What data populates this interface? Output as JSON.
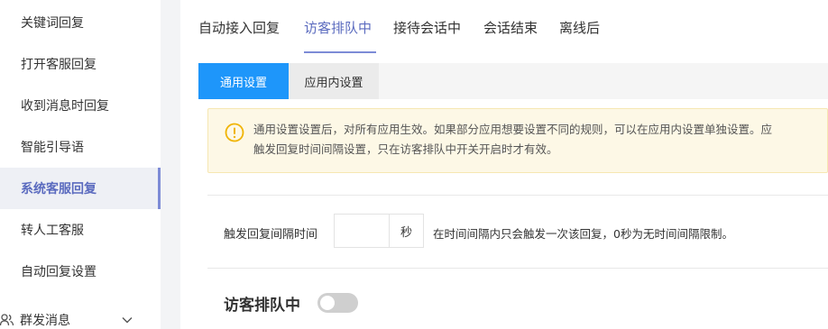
{
  "sidebar": {
    "items": [
      {
        "label": "关键词回复"
      },
      {
        "label": "打开客服回复"
      },
      {
        "label": "收到消息时回复"
      },
      {
        "label": "智能引导语"
      },
      {
        "label": "系统客服回复"
      },
      {
        "label": "转人工客服"
      },
      {
        "label": "自动回复设置"
      }
    ],
    "group": {
      "label": "群发消息",
      "icon": "users-icon",
      "chevron": "chevron-down-icon"
    }
  },
  "tabs": [
    {
      "label": "自动接入回复"
    },
    {
      "label": "访客排队中"
    },
    {
      "label": "接待会话中"
    },
    {
      "label": "会话结束"
    },
    {
      "label": "离线后"
    }
  ],
  "settings_scope": {
    "general": "通用设置",
    "in_app": "应用内设置"
  },
  "notice": {
    "icon": "warning-icon",
    "line1": "通用设置设置后，对所有应用生效。如果部分应用想要设置不同的规则，可以在应用内设置单独设置。应",
    "line2": "触发回复时间间隔设置，只在访客排队中开关开启时才有效。"
  },
  "interval": {
    "label": "触发回复间隔时间",
    "value": "",
    "unit": "秒",
    "hint": "在时间间隔内只会触发一次该回复，0秒为无时间间隔限制。"
  },
  "queue_section": {
    "title": "访客排队中",
    "enabled": false
  },
  "colors": {
    "accent": "#5b6bbf",
    "primary_button": "#1e96fa",
    "notice_bg": "#fdf8e6",
    "warning": "#f0b400"
  }
}
